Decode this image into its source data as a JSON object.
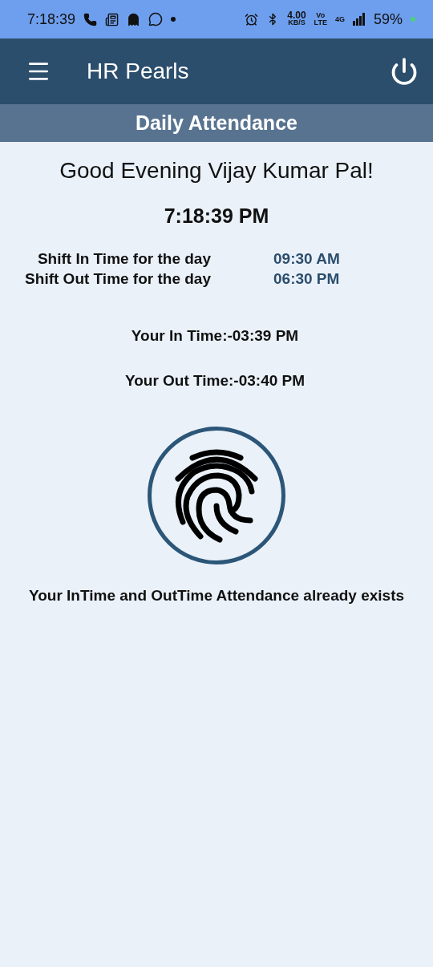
{
  "status_bar": {
    "time": "7:18:39",
    "speed": "4.00",
    "speed_unit": "KB/S",
    "volte_top": "Vo",
    "volte_bottom": "LTE",
    "network": "4G",
    "battery": "59%"
  },
  "app_bar": {
    "title": "HR Pearls"
  },
  "subheader": {
    "title": "Daily Attendance"
  },
  "greeting": "Good Evening Vijay Kumar Pal!",
  "clock": "7:18:39 PM",
  "shift": [
    {
      "label": "Shift In Time for the day",
      "value": "09:30 AM"
    },
    {
      "label": "Shift Out Time for the day",
      "value": "06:30 PM"
    }
  ],
  "punches": [
    "Your In Time:-03:39 PM",
    "Your Out Time:-03:40 PM"
  ],
  "message": "Your InTime and OutTime Attendance already exists"
}
